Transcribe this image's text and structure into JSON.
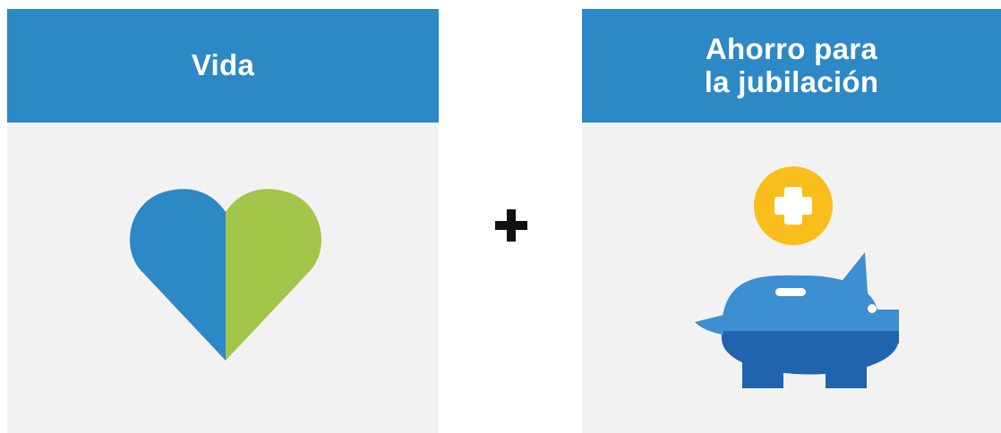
{
  "cards": [
    {
      "title_lines": [
        "Vida"
      ],
      "icon": "heart-icon"
    },
    {
      "title_lines": [
        "Ahorro para",
        "la jubilación"
      ],
      "icon": "piggy-bank-icon"
    }
  ],
  "connector": {
    "icon": "plus-icon"
  },
  "colors": {
    "header_blue": "#2d88c6",
    "panel_gray": "#f2f2f2",
    "heart_blue": "#2d88c6",
    "heart_green": "#a2c64a",
    "pig_light_blue": "#3c8fd0",
    "pig_dark_blue": "#1f64ad",
    "coin_yellow": "#f9be1b",
    "plus_black": "#111111"
  }
}
